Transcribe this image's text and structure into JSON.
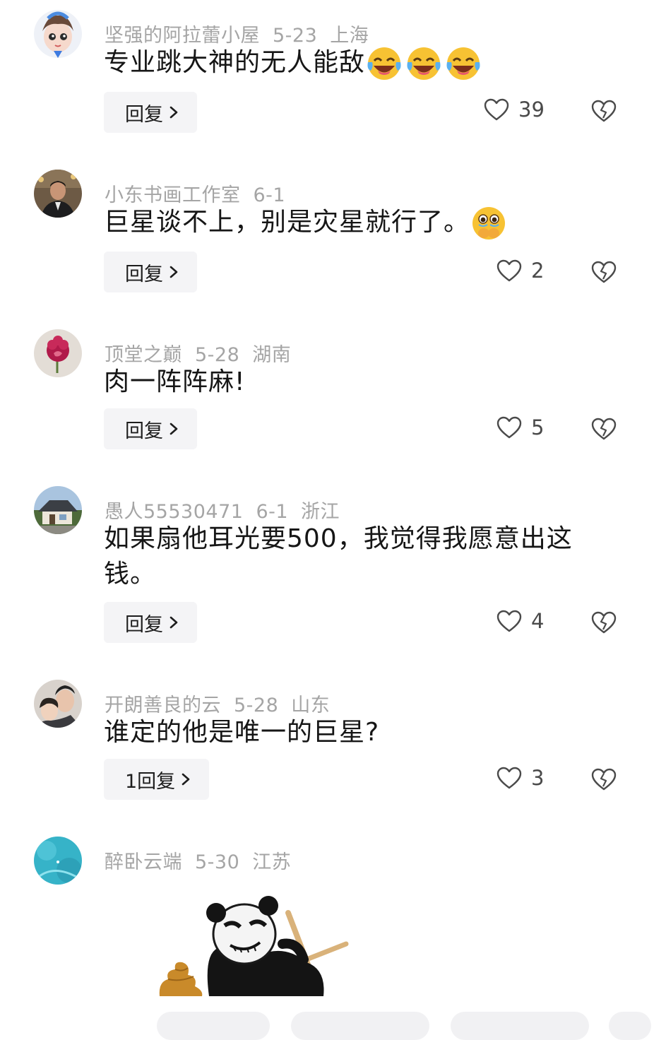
{
  "comments": [
    {
      "user": "坚强的阿拉蕾小屋",
      "date": "5-23",
      "location": "上海",
      "text": "专业跳大神的无人能敌",
      "emoji": "tears-of-joy-emoji",
      "emoji_count": 3,
      "reply_label": "回复",
      "likes": "39"
    },
    {
      "user": "小东书画工作室",
      "date": "6-1",
      "location": "",
      "text": "巨星谈不上，别是灾星就行了。",
      "emoji": "face-holding-back-tears-emoji",
      "emoji_count": 1,
      "reply_label": "回复",
      "likes": "2"
    },
    {
      "user": "顶堂之巅",
      "date": "5-28",
      "location": "湖南",
      "text": "肉一阵阵麻!",
      "reply_label": "回复",
      "likes": "5"
    },
    {
      "user": "愚人55530471",
      "date": "6-1",
      "location": "浙江",
      "text": "如果扇他耳光要500，我觉得我愿意出这钱。",
      "reply_label": "回复",
      "likes": "4"
    },
    {
      "user": "开朗善良的云",
      "date": "5-28",
      "location": "山东",
      "text": "谁定的他是唯一的巨星?",
      "reply_label": "1回复",
      "likes": "3"
    },
    {
      "user": "醉卧云端",
      "date": "5-30",
      "location": "江苏",
      "image": "panda-meme-sticker"
    }
  ],
  "icons": {
    "like": "heart-outline-icon",
    "dislike": "broken-heart-icon",
    "reply_arrow": "chevron-right-icon"
  },
  "colors": {
    "meta_text": "#a5a5a5",
    "body_text": "#161616",
    "reply_bg": "#f4f4f6",
    "icon": "#4a4a4a"
  }
}
